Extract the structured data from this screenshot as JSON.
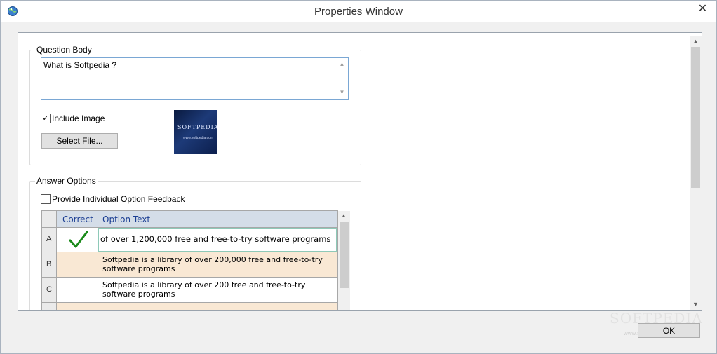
{
  "window": {
    "title": "Properties Window",
    "close_glyph": "✕",
    "app_icon": "globe-icon"
  },
  "question_body": {
    "group_label": "Question Body",
    "text": "What is Softpedia ?",
    "include_image_label": "Include Image",
    "include_image_checked": true,
    "select_file_label": "Select File...",
    "image_title": "SOFTPEDIA",
    "image_subtitle": "www.softpedia.com"
  },
  "answer_options": {
    "group_label": "Answer Options",
    "feedback_label": "Provide Individual Option Feedback",
    "feedback_checked": false,
    "columns": {
      "correct": "Correct",
      "option_text": "Option Text"
    },
    "rows": [
      {
        "key": "A",
        "correct": true,
        "text": "of over 1,200,000 free and free-to-try software programs"
      },
      {
        "key": "B",
        "correct": false,
        "text": "Softpedia is a library of over 200,000 free and free-to-try software programs"
      },
      {
        "key": "C",
        "correct": false,
        "text": "Softpedia is a library of over 200 free and free-to-try software programs"
      },
      {
        "key": "",
        "correct": false,
        "text": ""
      }
    ]
  },
  "footer": {
    "ok_label": "OK",
    "watermark": "SOFTPEDIA",
    "watermark_url": "www.softpedia.com"
  },
  "colors": {
    "alt_row": "#f9e8d4",
    "header_bg": "#d4dde8",
    "check_green": "#1a8a1a",
    "active_border": "#8ec9b8"
  }
}
